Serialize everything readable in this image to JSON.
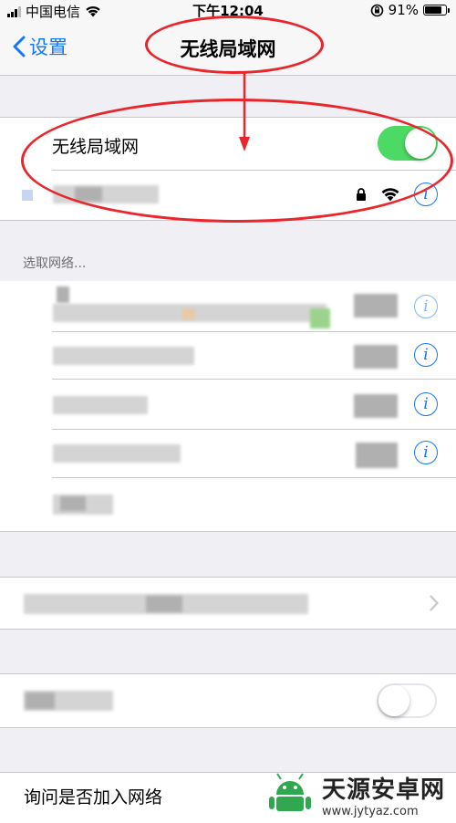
{
  "status_bar": {
    "carrier": "中国电信",
    "time": "下午12:04",
    "battery_percent": "91%",
    "battery_level": 0.91
  },
  "nav": {
    "back_label": "设置",
    "title": "无线局域网"
  },
  "wifi_toggle": {
    "label": "无线局域网",
    "state": "on"
  },
  "choose_network_header": "选取网络...",
  "ask_join": {
    "label": "询问是否加入网络"
  },
  "colors": {
    "accent": "#1478f6",
    "toggle_on": "#4cd964",
    "annotation": "#e8262b",
    "background": "#efeff4"
  },
  "watermark": {
    "title": "天源安卓网",
    "url": "www.jytyaz.com"
  }
}
